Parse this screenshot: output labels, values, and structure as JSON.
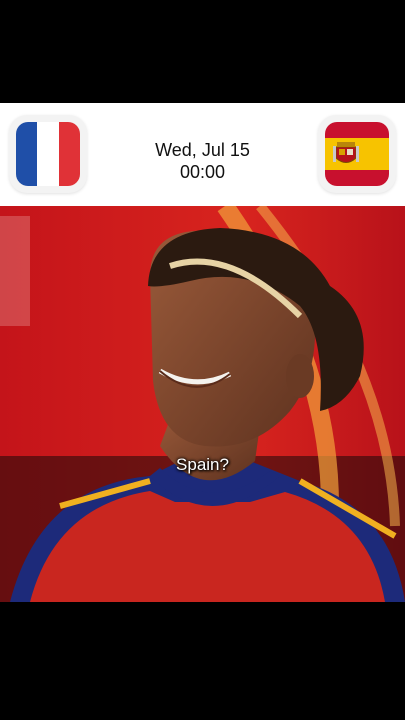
{
  "match": {
    "home_team": "France",
    "away_team": "Spain",
    "date": "Wed, Jul 15",
    "time": "00:00"
  },
  "video": {
    "caption": "Spain?"
  },
  "colors": {
    "france_blue": "#1f4fa8",
    "france_red": "#e03237",
    "spain_red": "#c8102e",
    "spain_yellow": "#f7c300"
  },
  "icons": {
    "home_flag": "france-flag-icon",
    "away_flag": "spain-flag-icon"
  }
}
